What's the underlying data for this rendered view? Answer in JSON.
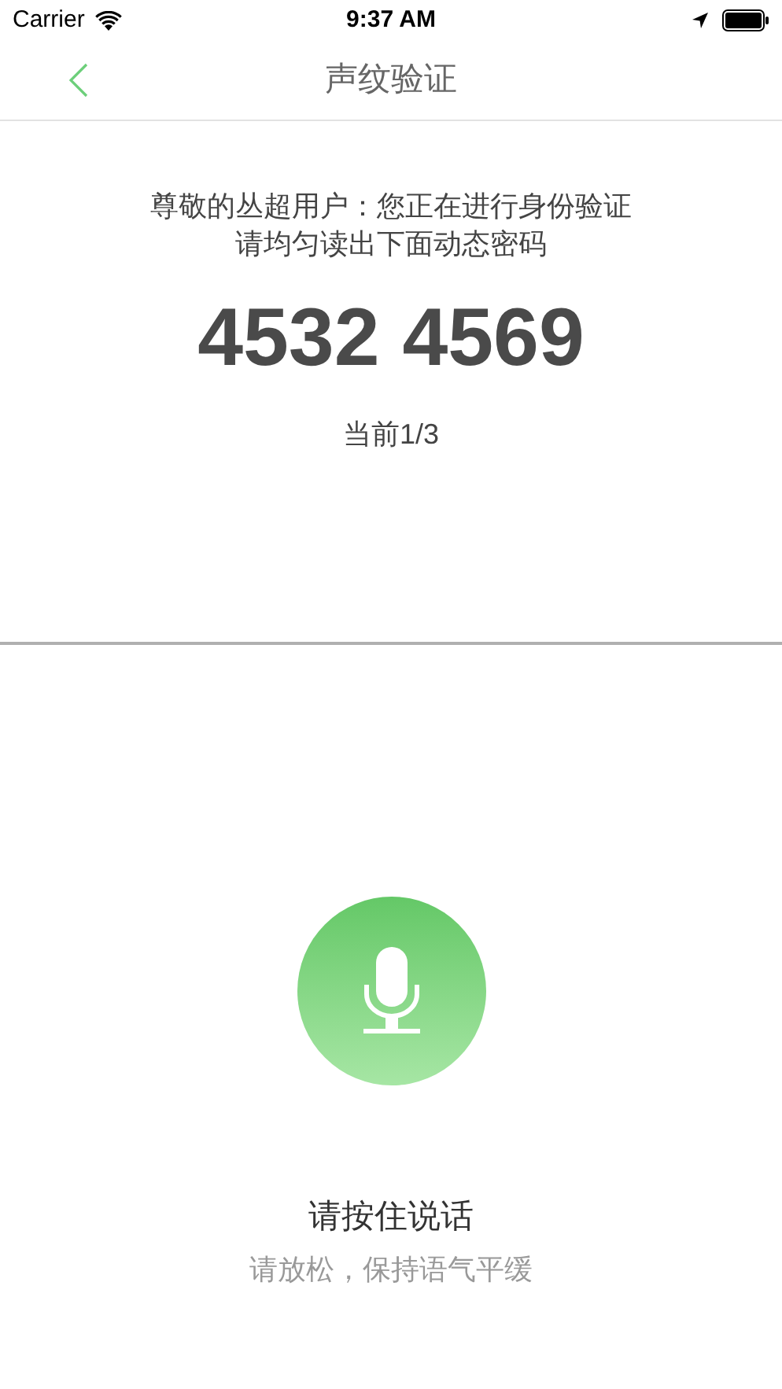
{
  "status_bar": {
    "carrier": "Carrier",
    "time": "9:37 AM"
  },
  "nav": {
    "title": "声纹验证"
  },
  "prompt": {
    "lines": [
      "尊敬的丛超用户：您正在进行身份验证",
      "请均匀读出下面动态密码"
    ],
    "code": "4532 4569",
    "progress": "当前1/3"
  },
  "record": {
    "label": "请按住说话",
    "hint": "请放松，保持语气平缓"
  }
}
